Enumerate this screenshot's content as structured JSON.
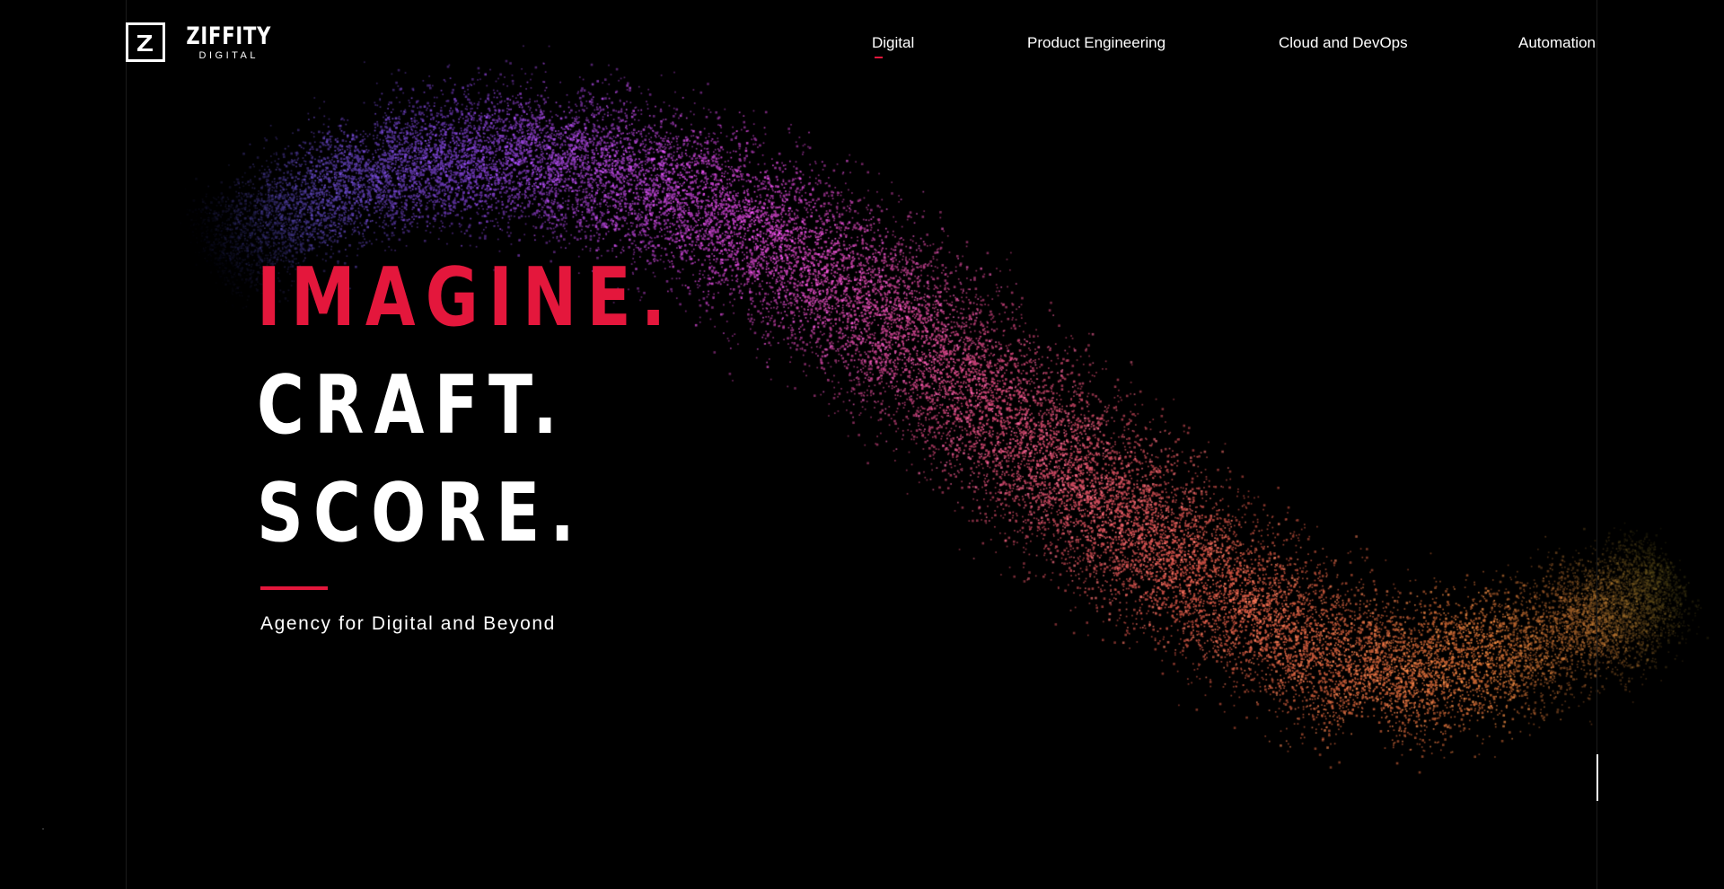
{
  "brand": {
    "logo_mark": "Z",
    "name": "ZIFFITY",
    "subtitle": "DIGITAL"
  },
  "nav": {
    "items": [
      {
        "label": "Digital",
        "active": true
      },
      {
        "label": "Product Engineering",
        "active": false
      },
      {
        "label": "Cloud and DevOps",
        "active": false
      },
      {
        "label": "Automation",
        "active": false
      }
    ]
  },
  "hero": {
    "line1": "IMAGINE.",
    "line2": "CRAFT.",
    "line3": "SCORE.",
    "tagline": "Agency for Digital and Beyond"
  },
  "colors": {
    "background": "#000000",
    "accent": "#e4173c",
    "text": "#ffffff",
    "particle_gradient": [
      "#3a3f8f",
      "#7a3fc9",
      "#d545d8",
      "#f0508a",
      "#f46050",
      "#e8773a",
      "#8a7a2a"
    ]
  },
  "icons": {
    "logo": "ziffity-z-logo-icon",
    "particle_wave": "particle-wave-graphic"
  }
}
